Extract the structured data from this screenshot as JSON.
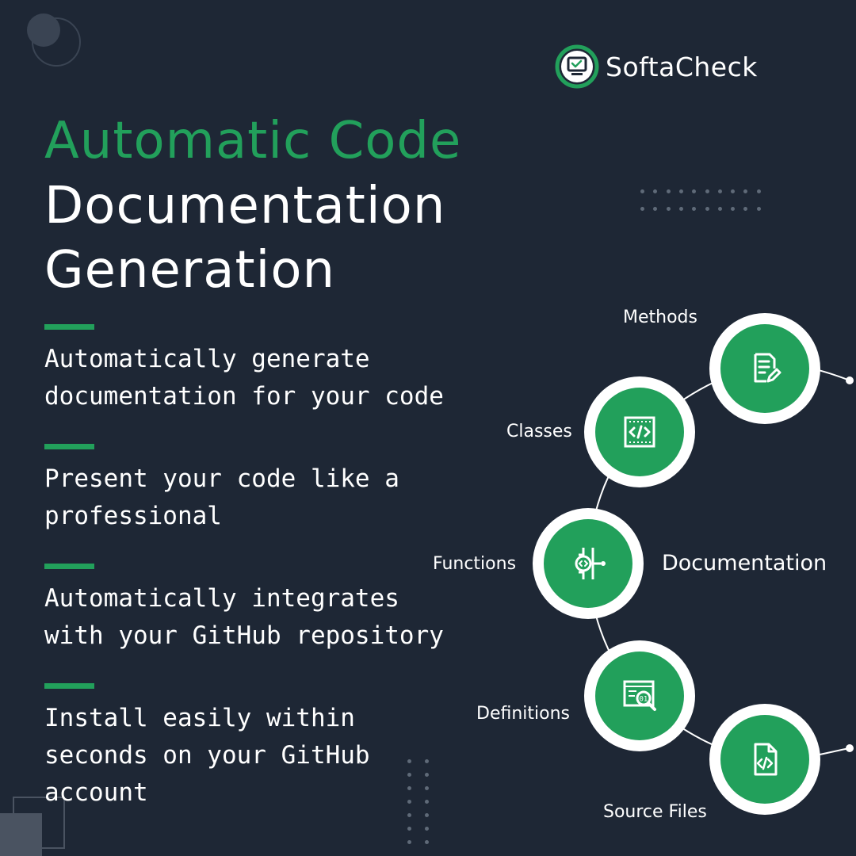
{
  "brand": {
    "name": "SoftaCheck",
    "accent": "#22a05b",
    "background": "#1e2735"
  },
  "heading": {
    "line1": "Automatic Code",
    "line2": "Documentation",
    "line3": "Generation"
  },
  "bullets": [
    {
      "text": "Automatically generate documentation for your code"
    },
    {
      "text": "Present your code like a professional"
    },
    {
      "text": "Automatically integrates with your GitHub repository"
    },
    {
      "text": "Install easily within seconds on your GitHub account"
    }
  ],
  "diagram": {
    "center_label": "Documentation",
    "nodes": [
      {
        "label": "Methods",
        "icon": "document-edit-icon"
      },
      {
        "label": "Classes",
        "icon": "code-window-icon"
      },
      {
        "label": "Functions",
        "icon": "function-gear-icon"
      },
      {
        "label": "Definitions",
        "icon": "binary-search-icon"
      },
      {
        "label": "Source Files",
        "icon": "code-file-icon"
      }
    ]
  }
}
